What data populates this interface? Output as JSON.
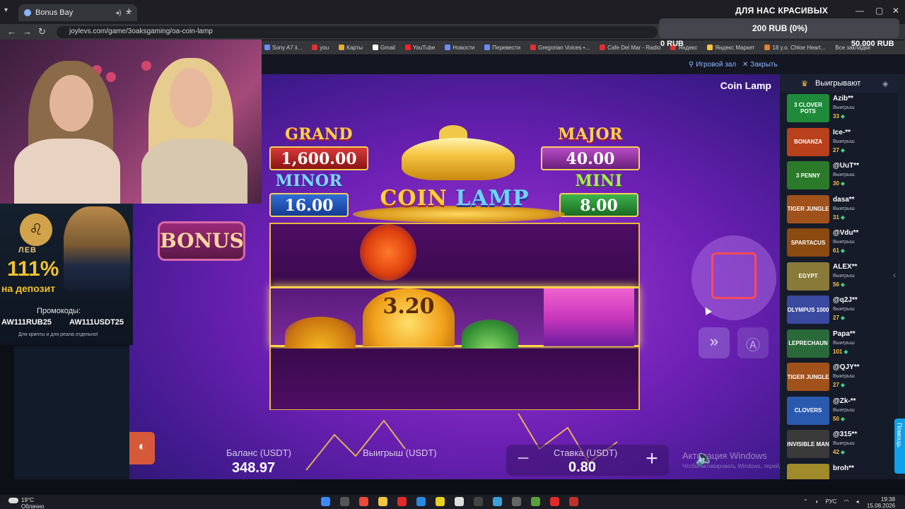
{
  "browser": {
    "tab_title": "Bonus Bay",
    "url": "joylevs.com/game/3oaksgaming/oa-coin-lamp",
    "bookmarks": [
      "Sony A7 ii...",
      "you",
      "Карты",
      "Gmail",
      "YouTube",
      "Новости",
      "Перевести",
      "Gregorian Voices •...",
      "Cafe Del Mar - Radio",
      "Яндекс",
      "Яндекс Маркет",
      "18 y.o. Chloe Heart...",
      "Все закладки"
    ]
  },
  "stream_overlay": {
    "title": "ДЛЯ НАС КРАСИВЫХ",
    "goal": "200 RUB (0%)",
    "start": "0 RUB",
    "target": "50.000 RUB"
  },
  "promo": {
    "brand": "ЛЕВ",
    "percent": "111%",
    "deposit": "на депозит",
    "codes_label": "Промокоды:",
    "code_rub": "AW111RUB25",
    "code_usdt": "AW111USDT25",
    "note": "Для крипты и для реала отдельно!"
  },
  "site_header": {
    "game_hall": "Игровой зал",
    "close": "Закрыть"
  },
  "game": {
    "title": "Coin Lamp",
    "jackpots": {
      "grand": {
        "label": "GRAND",
        "value": "1,600.00"
      },
      "major": {
        "label": "MAJOR",
        "value": "40.00"
      },
      "minor": {
        "label": "MINOR",
        "value": "16.00"
      },
      "mini": {
        "label": "MINI",
        "value": "8.00"
      }
    },
    "logo_a": "COIN",
    "logo_b": "LAMP",
    "bonus_label": "BONUS",
    "coin_value": "3.20",
    "balance_label": "Баланс (USDT)",
    "balance_value": "348.97",
    "win_label": "Выигрыш (USDT)",
    "bet_label": "Ставка (USDT)",
    "bet_value": "0.80",
    "minus": "−",
    "plus": "+",
    "watermark": "Активация Windows",
    "watermark_sub": "Чтобы активировать Windows, перейдите в раздел \"Параметры\"."
  },
  "winners": {
    "title": "Выигрывают",
    "win_word": "Выигрыш",
    "items": [
      {
        "name": "Azib**",
        "amount": "33",
        "game": "3 CLOVER POTS",
        "color": "#1e8a3a"
      },
      {
        "name": "Ice-**",
        "amount": "27",
        "game": "BONANZA",
        "color": "#b8401a"
      },
      {
        "name": "@UuT**",
        "amount": "30",
        "game": "3 PENNY",
        "color": "#2a7a2a"
      },
      {
        "name": "dasa**",
        "amount": "31",
        "game": "TIGER JUNGLE",
        "color": "#a0521a"
      },
      {
        "name": "@Vdu**",
        "amount": "61",
        "game": "SPARTACUS",
        "color": "#8a4a10"
      },
      {
        "name": "ALEX**",
        "amount": "56",
        "game": "EGYPT",
        "color": "#8a7a3a"
      },
      {
        "name": "@q2J**",
        "amount": "27",
        "game": "OLYMPUS 1000",
        "color": "#3a4aa0"
      },
      {
        "name": "Papa**",
        "amount": "101",
        "game": "LEPRECHAUN",
        "color": "#2a6a3a"
      },
      {
        "name": "@QJY**",
        "amount": "27",
        "game": "TIGER JUNGLE",
        "color": "#a0521a"
      },
      {
        "name": "@Zk-**",
        "amount": "50",
        "game": "CLOVERS",
        "color": "#2a5ab0"
      },
      {
        "name": "@315**",
        "amount": "42",
        "game": "INVISIBLE MAN",
        "color": "#3a3a3a"
      },
      {
        "name": "broh**",
        "amount": "",
        "game": "",
        "color": "#a08a2a"
      }
    ]
  },
  "help": "Помощь",
  "taskbar": {
    "temp": "19°C",
    "weather": "Облачно",
    "lang": "РУС",
    "time": "19:38",
    "date": "15.08.2026"
  }
}
